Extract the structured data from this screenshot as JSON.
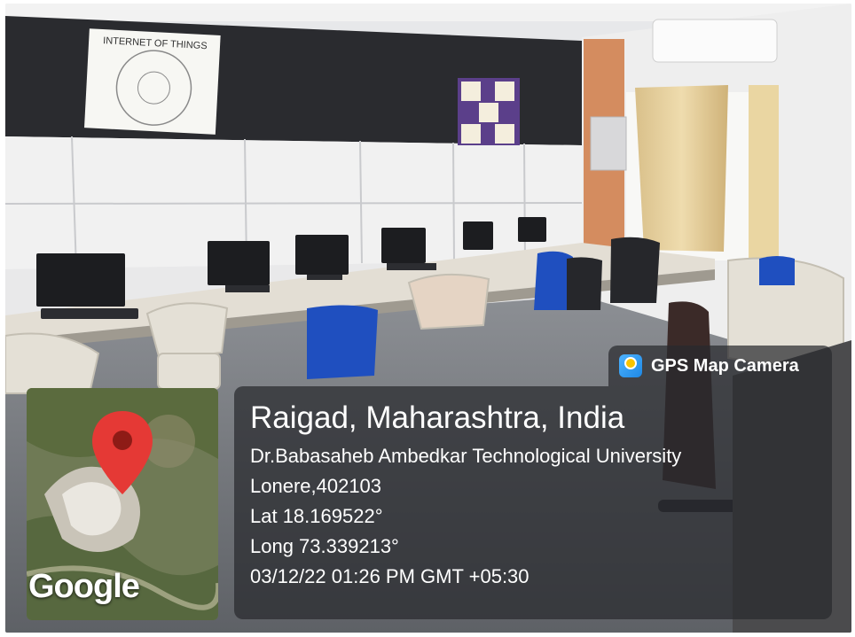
{
  "badge": {
    "app_name": "GPS Map Camera",
    "icon": "gps-map-camera-app-icon"
  },
  "location": {
    "title": "Raigad, Maharashtra, India",
    "institution": "Dr.Babasaheb Ambedkar Technological University",
    "address": "Lonere,402103",
    "latitude": "Lat 18.169522°",
    "longitude": "Long 73.339213°",
    "timestamp": "03/12/22 01:26 PM GMT +05:30"
  },
  "map": {
    "attribution": "Google",
    "marker_icon": "map-pin-icon",
    "marker_color": "#e53935"
  },
  "photo": {
    "poster_title": "INTERNET OF THINGS",
    "description_subject": "computer-lab"
  }
}
